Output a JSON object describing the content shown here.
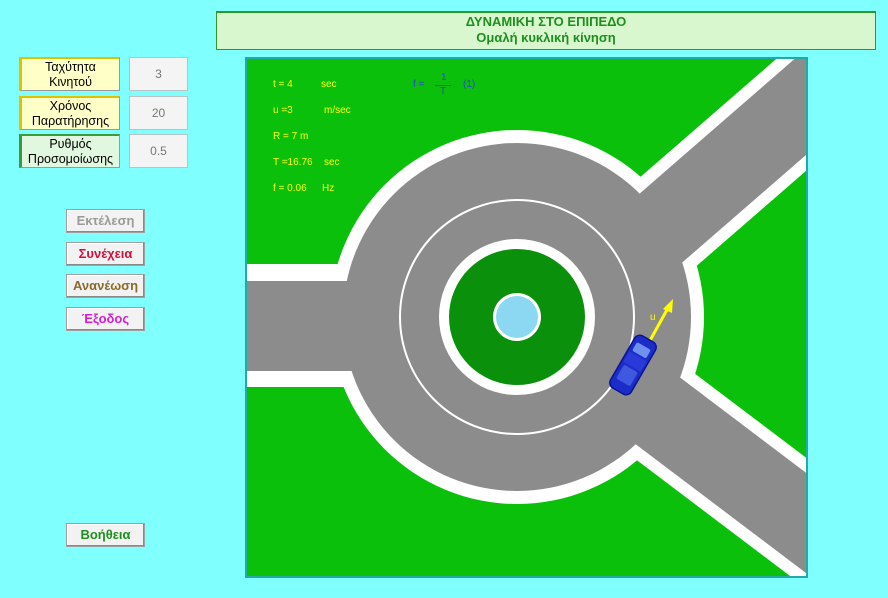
{
  "header": {
    "title": "ΔΥΝΑΜΙΚΗ ΣΤΟ ΕΠΙΠΕΔΟ",
    "subtitle": "Ομαλή κυκλική κίνηση"
  },
  "params": {
    "speed": {
      "label_line1": "Ταχύτητα",
      "label_line2": "Κινητού",
      "value": "3"
    },
    "obs_time": {
      "label_line1": "Χρόνος",
      "label_line2": "Παρατήρησης",
      "value": "20"
    },
    "sim_rate": {
      "label_line1": "Ρυθμός",
      "label_line2": "Προσομοίωσης",
      "value": "0.5"
    }
  },
  "buttons": {
    "run": "Εκτέλεση",
    "continue": "Συνέχεια",
    "refresh": "Ανανέωση",
    "exit": "Έξοδος",
    "help": "Βοήθεια"
  },
  "readouts": {
    "t_label": "t = 4",
    "t_unit": "sec",
    "u_label": "u =3",
    "u_unit": "m/sec",
    "R_label": "R = 7 m",
    "T_label": "T =16.76",
    "T_unit": "sec",
    "f_label": "f = 0.06",
    "f_unit": "Hz",
    "formula_prefix": "f =",
    "formula_num": "1",
    "formula_den": "T",
    "formula_ref": "(1)",
    "velocity_symbol": "u"
  },
  "colors": {
    "background": "#80ffff",
    "grass": "#0bc00b",
    "road": "#8c8c8c",
    "car": "#1c2cc8",
    "velocity_arrow": "#ffff00",
    "button_run": "#9a9a9a",
    "button_continue": "#d0103c",
    "button_refresh": "#8a6a2a",
    "button_exit": "#d020d0",
    "button_help": "#1e8f1e"
  }
}
